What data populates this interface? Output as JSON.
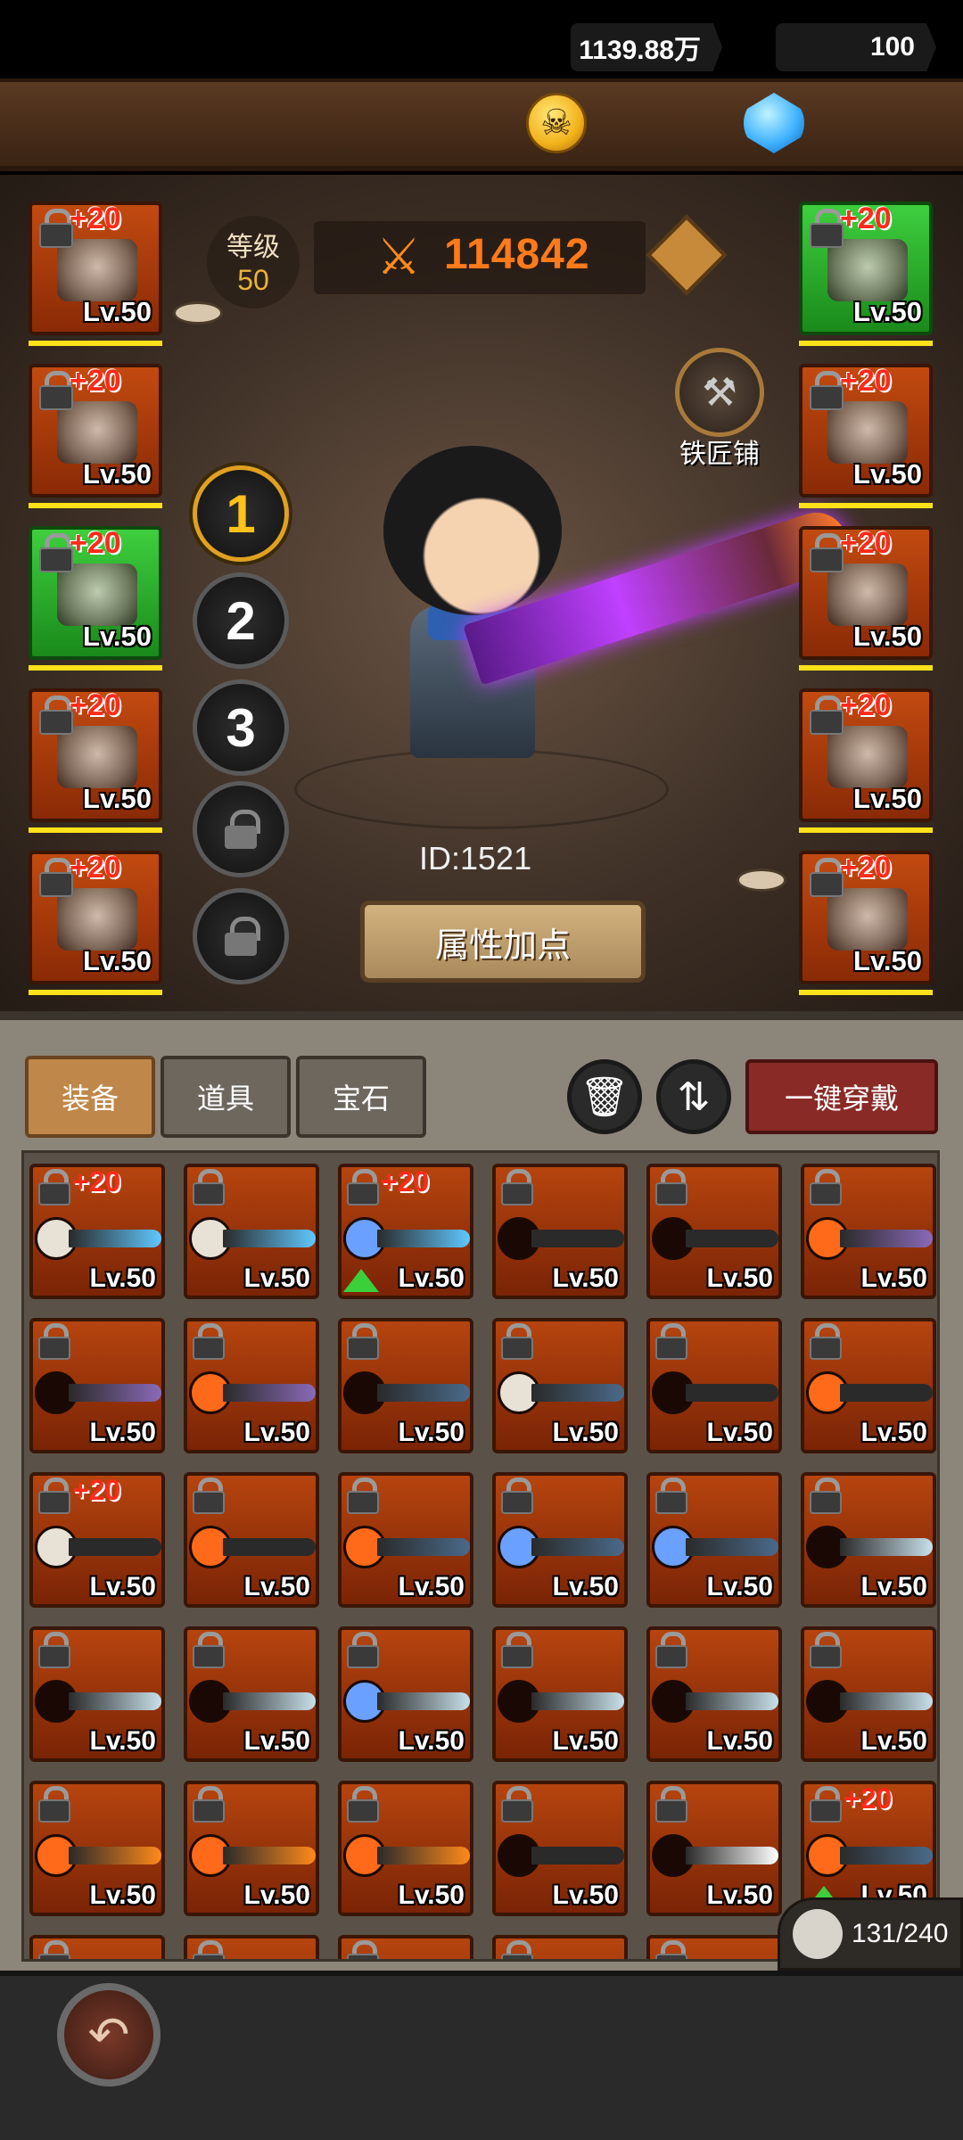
{
  "currency": {
    "gold": "1139.88万",
    "gems": "100"
  },
  "hero": {
    "level_label": "等级",
    "level_value": "50",
    "power": "114842",
    "player_id": "ID:1521",
    "smithy_label": "铁匠铺",
    "attr_button": "属性加点"
  },
  "equip_left": [
    {
      "plus": "+20",
      "level": "Lv.50",
      "color": "orange"
    },
    {
      "plus": "+20",
      "level": "Lv.50",
      "color": "orange"
    },
    {
      "plus": "+20",
      "level": "Lv.50",
      "color": "green"
    },
    {
      "plus": "+20",
      "level": "Lv.50",
      "color": "orange"
    },
    {
      "plus": "+20",
      "level": "Lv.50",
      "color": "orange"
    }
  ],
  "equip_right": [
    {
      "plus": "+20",
      "level": "Lv.50",
      "color": "green"
    },
    {
      "plus": "+20",
      "level": "Lv.50",
      "color": "orange"
    },
    {
      "plus": "+20",
      "level": "Lv.50",
      "color": "orange"
    },
    {
      "plus": "+20",
      "level": "Lv.50",
      "color": "orange"
    },
    {
      "plus": "+20",
      "level": "Lv.50",
      "color": "orange"
    }
  ],
  "presets": [
    "1",
    "2",
    "3"
  ],
  "tabs": {
    "equipment": "装备",
    "items": "道具",
    "gems": "宝石"
  },
  "equip_all": "一键穿戴",
  "bag": "131/240",
  "inventory": [
    {
      "plus": "+20",
      "orb": "white",
      "blade": "ice",
      "up": false
    },
    {
      "plus": "",
      "orb": "white",
      "blade": "ice",
      "up": false
    },
    {
      "plus": "+20",
      "orb": "blue",
      "blade": "ice",
      "up": true
    },
    {
      "plus": "",
      "orb": "none",
      "blade": "dark",
      "up": false
    },
    {
      "plus": "",
      "orb": "none",
      "blade": "dark",
      "up": false
    },
    {
      "plus": "",
      "orb": "red",
      "blade": "purple",
      "up": false
    },
    {
      "plus": "",
      "orb": "none",
      "blade": "purple",
      "up": false
    },
    {
      "plus": "",
      "orb": "red",
      "blade": "purple",
      "up": false
    },
    {
      "plus": "",
      "orb": "none",
      "blade": "steelblue",
      "up": false
    },
    {
      "plus": "",
      "orb": "white",
      "blade": "steelblue",
      "up": false
    },
    {
      "plus": "",
      "orb": "none",
      "blade": "dark",
      "up": false
    },
    {
      "plus": "",
      "orb": "red",
      "blade": "dark",
      "up": false
    },
    {
      "plus": "+20",
      "orb": "white",
      "blade": "dark",
      "up": false
    },
    {
      "plus": "",
      "orb": "red",
      "blade": "dark",
      "up": false
    },
    {
      "plus": "",
      "orb": "red",
      "blade": "steelblue",
      "up": false
    },
    {
      "plus": "",
      "orb": "blue",
      "blade": "steelblue",
      "up": false
    },
    {
      "plus": "",
      "orb": "blue",
      "blade": "steelblue",
      "up": false
    },
    {
      "plus": "",
      "orb": "none",
      "blade": "silver",
      "up": false
    },
    {
      "plus": "",
      "orb": "none",
      "blade": "silver",
      "up": false
    },
    {
      "plus": "",
      "orb": "none",
      "blade": "silver",
      "up": false
    },
    {
      "plus": "",
      "orb": "blue",
      "blade": "silver",
      "up": false
    },
    {
      "plus": "",
      "orb": "none",
      "blade": "silver",
      "up": false
    },
    {
      "plus": "",
      "orb": "none",
      "blade": "silver",
      "up": false
    },
    {
      "plus": "",
      "orb": "none",
      "blade": "silver",
      "up": false
    },
    {
      "plus": "",
      "orb": "red",
      "blade": "fire",
      "up": false
    },
    {
      "plus": "",
      "orb": "red",
      "blade": "fire",
      "up": false
    },
    {
      "plus": "",
      "orb": "red",
      "blade": "fire",
      "up": false
    },
    {
      "plus": "",
      "orb": "none",
      "blade": "dark",
      "up": false
    },
    {
      "plus": "",
      "orb": "none",
      "blade": "white",
      "up": false
    },
    {
      "plus": "+20",
      "orb": "red",
      "blade": "steelblue",
      "up": true
    }
  ],
  "slot_level": "Lv.50",
  "colors": {
    "orb": {
      "white": "#e8e2d6",
      "blue": "#6aa0ff",
      "red": "#ff6a1a",
      "none": "#1a0804"
    },
    "blade": {
      "ice": "#5fc8ff",
      "dark": "#2a2a2a",
      "purple": "#8a6ab8",
      "steelblue": "#4a6a8a",
      "silver": "#c8e0ea",
      "fire": "#ff8a1a",
      "white": "#ffffff"
    }
  }
}
